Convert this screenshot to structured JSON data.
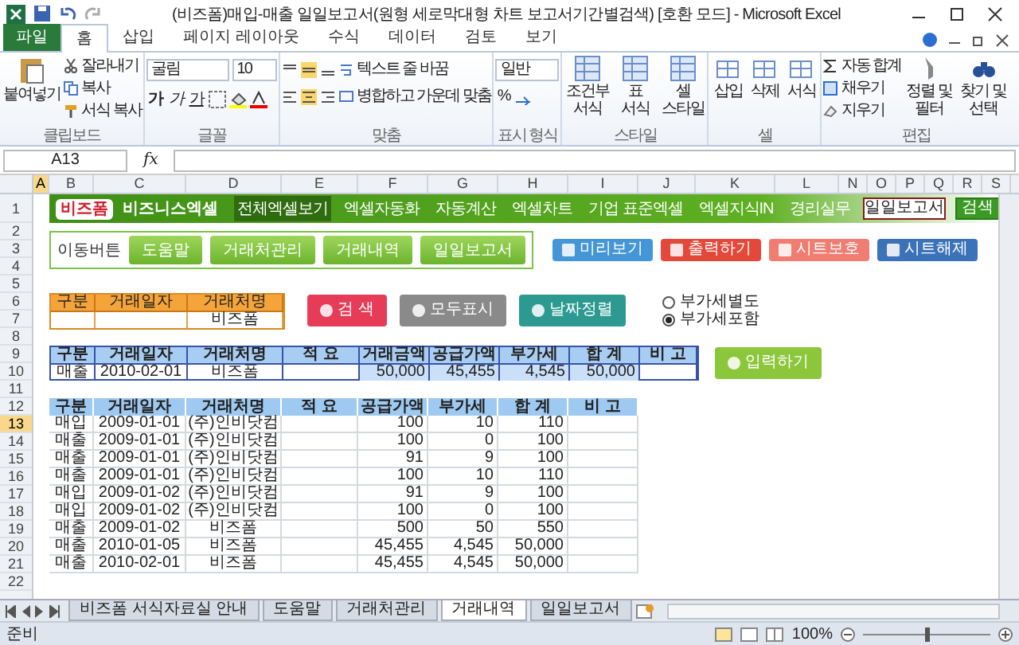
{
  "window": {
    "title": "(비즈폼)매입-매출 일일보고서(원형 세로막대형 차트 보고서기간별검색) [호환 모드] - Microsoft Excel"
  },
  "ribbon_tabs": [
    {
      "label": "파일",
      "kind": "file",
      "selected": false
    },
    {
      "label": "홈",
      "kind": "tab",
      "selected": true
    },
    {
      "label": "삽입",
      "kind": "tab",
      "selected": false
    },
    {
      "label": "페이지 레이아웃",
      "kind": "tab",
      "selected": false
    },
    {
      "label": "수식",
      "kind": "tab",
      "selected": false
    },
    {
      "label": "데이터",
      "kind": "tab",
      "selected": false
    },
    {
      "label": "검토",
      "kind": "tab",
      "selected": false
    },
    {
      "label": "보기",
      "kind": "tab",
      "selected": false
    }
  ],
  "ribbon": {
    "clipboard": {
      "label": "클립보드",
      "paste": "붙여넣기",
      "cut": "잘라내기",
      "copy": "복사",
      "format_painter": "서식 복사"
    },
    "font": {
      "label": "글꼴",
      "font_name": "굴림",
      "font_size": "10",
      "style_buttons": [
        "가",
        "가",
        "가"
      ]
    },
    "alignment": {
      "label": "맞춤",
      "wrap_text": "텍스트 줄 바꿈",
      "merge_center": "병합하고 가운데 맞춤"
    },
    "number": {
      "label": "표시 형식",
      "format": "일반",
      "percent": "%"
    },
    "styles": {
      "label": "스타일",
      "buttons": [
        "조건부 서식",
        "표 서식",
        "셀 스타일"
      ]
    },
    "cells": {
      "label": "셀",
      "buttons": [
        "삽입",
        "삭제",
        "서식"
      ]
    },
    "editing": {
      "label": "편집",
      "autosum": "자동 합계",
      "fill": "채우기",
      "clear": "지우기",
      "sort_filter": "정렬 및 필터",
      "find_select": "찾기 및 선택"
    }
  },
  "formula_bar": {
    "name_box": "A13",
    "fx": "fx"
  },
  "sheet": {
    "column_headers": [
      {
        "label": "A",
        "selected": true
      },
      {
        "label": "B",
        "selected": false
      },
      {
        "label": "C",
        "selected": false
      },
      {
        "label": "D",
        "selected": false
      },
      {
        "label": "E",
        "selected": false
      },
      {
        "label": "F",
        "selected": false
      },
      {
        "label": "G",
        "selected": false
      },
      {
        "label": "H",
        "selected": false
      },
      {
        "label": "I",
        "selected": false
      },
      {
        "label": "J",
        "selected": false
      },
      {
        "label": "K",
        "selected": false
      },
      {
        "label": "L",
        "selected": false
      },
      {
        "label": "N",
        "selected": false
      },
      {
        "label": "O",
        "selected": false
      },
      {
        "label": "P",
        "selected": false
      },
      {
        "label": "Q",
        "selected": false
      },
      {
        "label": "R",
        "selected": false
      },
      {
        "label": "S",
        "selected": false
      }
    ],
    "row_headers": [
      {
        "label": "1",
        "selected": false
      },
      {
        "label": "2",
        "selected": false
      },
      {
        "label": "3",
        "selected": false
      },
      {
        "label": "4",
        "selected": false
      },
      {
        "label": "5",
        "selected": false
      },
      {
        "label": "6",
        "selected": false
      },
      {
        "label": "7",
        "selected": false
      },
      {
        "label": "8",
        "selected": false
      },
      {
        "label": "9",
        "selected": false
      },
      {
        "label": "10",
        "selected": false
      },
      {
        "label": "11",
        "selected": false
      },
      {
        "label": "12",
        "selected": false
      },
      {
        "label": "13",
        "selected": true
      },
      {
        "label": "14",
        "selected": false
      },
      {
        "label": "15",
        "selected": false
      },
      {
        "label": "16",
        "selected": false
      },
      {
        "label": "17",
        "selected": false
      },
      {
        "label": "18",
        "selected": false
      },
      {
        "label": "19",
        "selected": false
      },
      {
        "label": "20",
        "selected": false
      },
      {
        "label": "21",
        "selected": false
      },
      {
        "label": "22",
        "selected": false
      }
    ]
  },
  "banner": {
    "logo": "비즈폼",
    "brand": "비즈니스엑셀",
    "menu": [
      {
        "label": "전체엑셀보기",
        "selected": true
      },
      {
        "label": "엑셀자동화",
        "selected": false
      },
      {
        "label": "자동계산",
        "selected": false
      },
      {
        "label": "엑셀차트",
        "selected": false
      },
      {
        "label": "기업 표준엑셀",
        "selected": false
      },
      {
        "label": "엑셀지식IN",
        "selected": false
      },
      {
        "label": "경리실무",
        "selected": false
      }
    ],
    "search_value": "일일보고서",
    "search_button": "검색"
  },
  "navigation": {
    "label": "이동버튼",
    "buttons": [
      "도움말",
      "거래처관리",
      "거래내역",
      "일일보고서"
    ]
  },
  "actions": [
    {
      "label": "미리보기",
      "kind": "preview"
    },
    {
      "label": "출력하기",
      "kind": "print"
    },
    {
      "label": "시트보호",
      "kind": "lock"
    },
    {
      "label": "시트해제",
      "kind": "unlock"
    }
  ],
  "search_form": {
    "headers": [
      "구분",
      "거래일자",
      "거래처명"
    ],
    "values": {
      "client": "비즈폼"
    },
    "buttons": [
      {
        "label": "검 색",
        "kind": "search"
      },
      {
        "label": "모두표시",
        "kind": "show_all"
      },
      {
        "label": "날짜정렬",
        "kind": "sort"
      }
    ],
    "vat_options": [
      {
        "label": "부가세별도",
        "selected": false
      },
      {
        "label": "부가세포함",
        "selected": true
      }
    ]
  },
  "entry": {
    "columns": [
      "구분",
      "거래일자",
      "거래처명",
      "적 요",
      "거래금액",
      "공급가액",
      "부가세",
      "합 계",
      "비 고"
    ],
    "row": {
      "kind": "매출",
      "date": "2010-02-01",
      "client": "비즈폼",
      "amount": "50,000",
      "supply": "45,455",
      "vat": "4,545",
      "total": "50,000"
    },
    "submit": "입력하기"
  },
  "ledger": {
    "columns": [
      "구분",
      "거래일자",
      "거래처명",
      "적 요",
      "공급가액",
      "부가세",
      "합 계",
      "비 고"
    ],
    "rows": [
      {
        "kind": "매입",
        "date": "2009-01-01",
        "client": "(주)인비닷컴",
        "supply": "100",
        "vat": "10",
        "total": "110"
      },
      {
        "kind": "매출",
        "date": "2009-01-01",
        "client": "(주)인비닷컴",
        "supply": "100",
        "vat": "0",
        "total": "100"
      },
      {
        "kind": "매출",
        "date": "2009-01-01",
        "client": "(주)인비닷컴",
        "supply": "91",
        "vat": "9",
        "total": "100"
      },
      {
        "kind": "매출",
        "date": "2009-01-01",
        "client": "(주)인비닷컴",
        "supply": "100",
        "vat": "10",
        "total": "110"
      },
      {
        "kind": "매입",
        "date": "2009-01-02",
        "client": "(주)인비닷컴",
        "supply": "91",
        "vat": "9",
        "total": "100"
      },
      {
        "kind": "매입",
        "date": "2009-01-02",
        "client": "(주)인비닷컴",
        "supply": "100",
        "vat": "0",
        "total": "100"
      },
      {
        "kind": "매출",
        "date": "2009-01-02",
        "client": "비즈폼",
        "supply": "500",
        "vat": "50",
        "total": "550"
      },
      {
        "kind": "매출",
        "date": "2010-01-05",
        "client": "비즈폼",
        "supply": "45,455",
        "vat": "4,545",
        "total": "50,000"
      },
      {
        "kind": "매출",
        "date": "2010-02-01",
        "client": "비즈폼",
        "supply": "45,455",
        "vat": "4,545",
        "total": "50,000"
      }
    ]
  },
  "sheet_tabs": [
    {
      "label": "비즈폼 서식자료실 안내",
      "selected": false
    },
    {
      "label": "도움말",
      "selected": false
    },
    {
      "label": "거래처관리",
      "selected": false
    },
    {
      "label": "거래내역",
      "selected": true
    },
    {
      "label": "일일보고서",
      "selected": false
    }
  ],
  "status_bar": {
    "status": "준비",
    "zoom": {
      "reading": "100%",
      "level": 0.5
    }
  }
}
